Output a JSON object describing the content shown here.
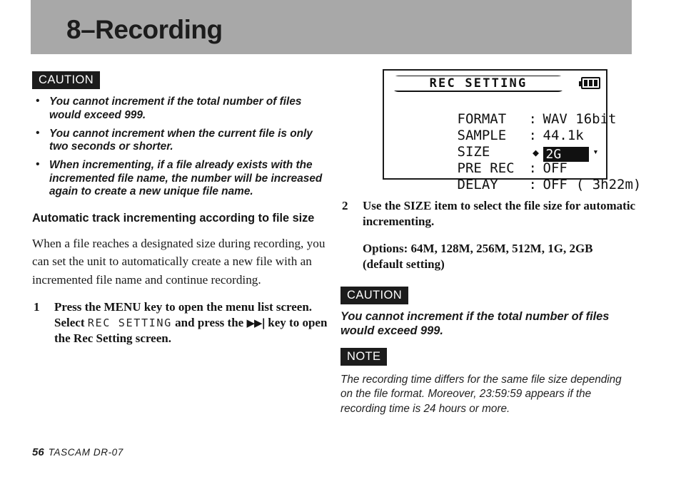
{
  "header": {
    "chapter_title": "8–Recording"
  },
  "left_column": {
    "caution_label": "CAUTION",
    "caution_bullets": [
      "You cannot increment if the total number of files would exceed 999.",
      "You cannot increment when the current file is only two seconds or shorter.",
      "When incrementing, if a file already exists with the incremented file name, the number will be increased again to create a new unique file name."
    ],
    "section_heading": "Automatic track incrementing according to file size",
    "body_paragraph": "When a file reaches a designated size during recording, you can set the unit to automatically create a new file with an incremented file name and continue recording.",
    "step1": {
      "number": "1",
      "text_before": "Press the MENU key to open the menu list screen. Select ",
      "lcd_term": "REC SETTING",
      "text_middle": " and press the ",
      "skip_icon": "▶▶|",
      "text_after": " key to open the Rec Setting screen."
    }
  },
  "lcd_screen": {
    "title": "REC SETTING",
    "battery_icon": "battery-full-icon",
    "battery_bars": 3,
    "rows": [
      {
        "label": "FORMAT",
        "separator": ":",
        "value": "WAV 16bit",
        "extra": ""
      },
      {
        "label": "SAMPLE",
        "separator": ":",
        "value": "44.1k",
        "extra": ""
      },
      {
        "label": "SIZE",
        "separator": "",
        "value": "2G",
        "extra": "",
        "selected": true,
        "cursor_icon": "◆",
        "dropdown_icon": "▾"
      },
      {
        "label": "PRE REC",
        "separator": ":",
        "value": "OFF",
        "extra": ""
      },
      {
        "label": "DELAY",
        "separator": ":",
        "value": "OFF",
        "extra": "( 3h22m)"
      }
    ]
  },
  "right_column": {
    "step2": {
      "number": "2",
      "text": "Use the SIZE item to select the file size for automatic incrementing."
    },
    "options_line": "Options: 64M, 128M, 256M, 512M, 1G, 2GB (default setting)",
    "caution_label": "CAUTION",
    "caution_body": "You cannot increment if the total number of files would exceed 999.",
    "note_label": "NOTE",
    "note_body": "The recording time differs for the same file size depending on the file format. Moreover, 23:59:59 appears if the recording time is 24 hours or more."
  },
  "footer": {
    "page_number": "56",
    "brand": "TASCAM DR-07"
  },
  "colors": {
    "banner_gray": "#a8a8a8",
    "callout_black": "#1c1c1c",
    "text_black": "#1a1a1a",
    "page_white": "#ffffff"
  }
}
